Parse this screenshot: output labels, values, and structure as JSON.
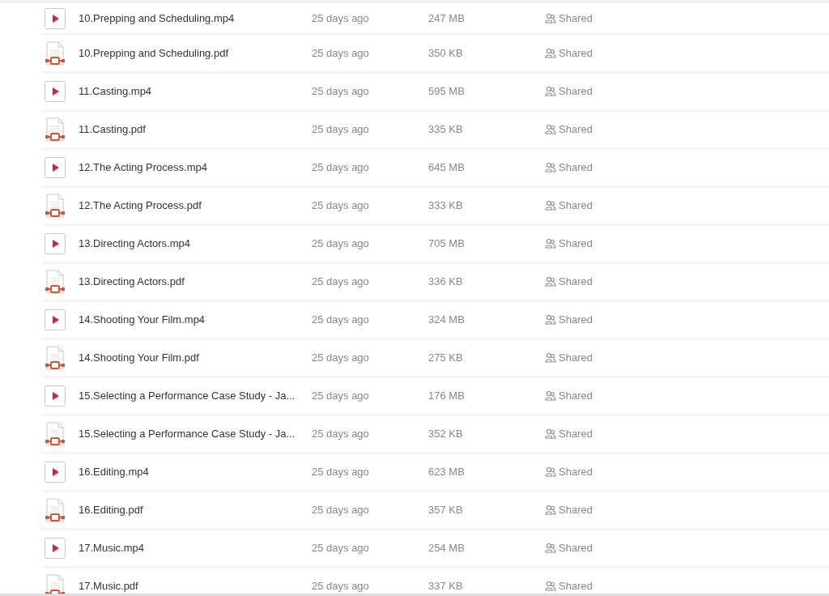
{
  "files": [
    {
      "kind": "video",
      "name": "10.Prepping and Scheduling.mp4",
      "modified": "25 days ago",
      "size": "247 MB",
      "sharing": "Shared"
    },
    {
      "kind": "pdf",
      "name": "10.Prepping and Scheduling.pdf",
      "modified": "25 days ago",
      "size": "350 KB",
      "sharing": "Shared"
    },
    {
      "kind": "video",
      "name": "11.Casting.mp4",
      "modified": "25 days ago",
      "size": "595 MB",
      "sharing": "Shared"
    },
    {
      "kind": "pdf",
      "name": "11.Casting.pdf",
      "modified": "25 days ago",
      "size": "335 KB",
      "sharing": "Shared"
    },
    {
      "kind": "video",
      "name": "12.The Acting Process.mp4",
      "modified": "25 days ago",
      "size": "645 MB",
      "sharing": "Shared"
    },
    {
      "kind": "pdf",
      "name": "12.The Acting Process.pdf",
      "modified": "25 days ago",
      "size": "333 KB",
      "sharing": "Shared"
    },
    {
      "kind": "video",
      "name": "13.Directing Actors.mp4",
      "modified": "25 days ago",
      "size": "705 MB",
      "sharing": "Shared"
    },
    {
      "kind": "pdf",
      "name": "13.Directing Actors.pdf",
      "modified": "25 days ago",
      "size": "336 KB",
      "sharing": "Shared"
    },
    {
      "kind": "video",
      "name": "14.Shooting Your Film.mp4",
      "modified": "25 days ago",
      "size": "324 MB",
      "sharing": "Shared"
    },
    {
      "kind": "pdf",
      "name": "14.Shooting Your Film.pdf",
      "modified": "25 days ago",
      "size": "275 KB",
      "sharing": "Shared"
    },
    {
      "kind": "video",
      "name": "15.Selecting a Performance Case Study - Ja...",
      "modified": "25 days ago",
      "size": "176 MB",
      "sharing": "Shared"
    },
    {
      "kind": "pdf",
      "name": "15.Selecting a Performance Case Study - Ja...",
      "modified": "25 days ago",
      "size": "352 KB",
      "sharing": "Shared"
    },
    {
      "kind": "video",
      "name": "16.Editing.mp4",
      "modified": "25 days ago",
      "size": "623 MB",
      "sharing": "Shared"
    },
    {
      "kind": "pdf",
      "name": "16.Editing.pdf",
      "modified": "25 days ago",
      "size": "357 KB",
      "sharing": "Shared"
    },
    {
      "kind": "video",
      "name": "17.Music.mp4",
      "modified": "25 days ago",
      "size": "254 MB",
      "sharing": "Shared"
    },
    {
      "kind": "pdf",
      "name": "17.Music.pdf",
      "modified": "25 days ago",
      "size": "337 KB",
      "sharing": "Shared"
    }
  ]
}
